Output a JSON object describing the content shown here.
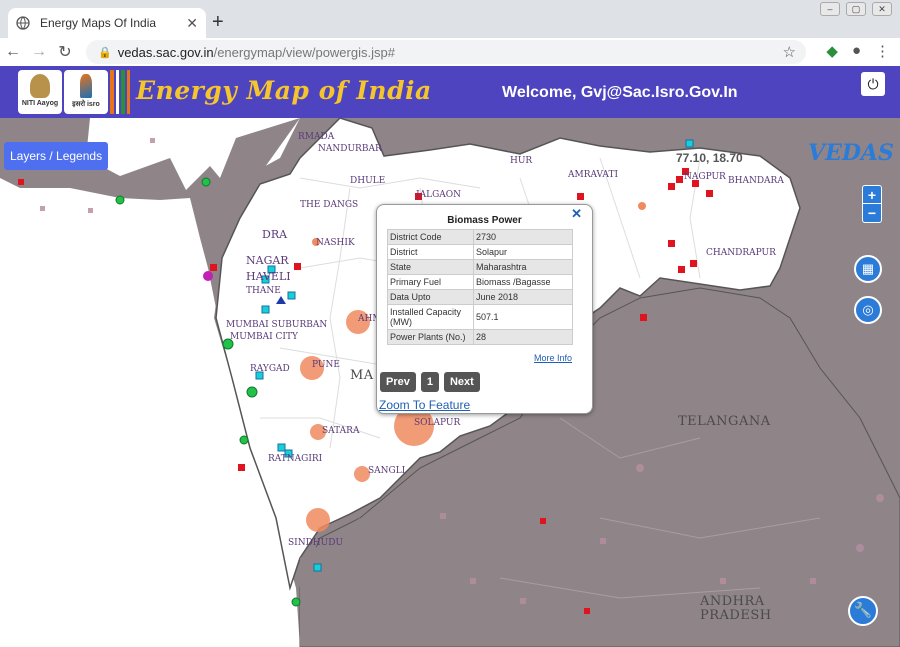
{
  "browser": {
    "tab_title": "Energy Maps Of India",
    "new_tab": "+",
    "url_host": "vedas.sac.gov.in",
    "url_path": "/energymap/view/powergis.jsp#"
  },
  "header": {
    "logo_niti": "NITI Aayog",
    "logo_isro": "इसरो isro",
    "title": "Energy Map of India",
    "welcome": "Welcome, Gvj@Sac.Isro.Gov.In",
    "brand_color": "#4e44bf",
    "title_color": "#f5c52d"
  },
  "map": {
    "layers_button": "Layers / Legends",
    "coordinates": "77.10, 18.70",
    "vedas_logo": "VEDAS",
    "zoom_in": "+",
    "zoom_out": "−",
    "labels": {
      "narmada": "RMADA",
      "nandurbar": "NANDURBAR",
      "dhule": "DHULE",
      "jalgaon": "JALGAON",
      "dangs": "THE DANGS",
      "nashik": "NASHIK",
      "dra": "DRA",
      "nagar": "NAGAR",
      "haveli": "HAVELI",
      "thane": "THANE",
      "mumbai_sub": "MUMBAI SUBURBAN",
      "mumbai_city": "MUMBAI CITY",
      "raygad": "RAYGAD",
      "pune": "PUNE",
      "ma": "MA",
      "ahm": "AHM",
      "satara": "SATARA",
      "ratnagiri": "RATNAGIRI",
      "sangli": "SANGLI",
      "solapur": "SOLAPUR",
      "sindhudurg": "SINDHUDU",
      "hur": "HUR",
      "amravati": "AMRAVATI",
      "nagpur": "NAGPUR",
      "bhandara": "BHANDARA",
      "chandrapur": "CHANDRAPUR",
      "telangana": "TELANGANA",
      "andhra": "ANDHRA",
      "pradesh": "PRADESH"
    }
  },
  "popup": {
    "title": "Biomass Power",
    "close": "✕",
    "rows": [
      {
        "key": "District Code",
        "value": "2730"
      },
      {
        "key": "District",
        "value": "Solapur"
      },
      {
        "key": "State",
        "value": "Maharashtra"
      },
      {
        "key": "Primary Fuel",
        "value": "Biomass /Bagasse"
      },
      {
        "key": "Data Upto",
        "value": "June 2018"
      },
      {
        "key": "Installed Capacity (MW)",
        "value": "507.1"
      },
      {
        "key": "Power Plants (No.)",
        "value": "28"
      }
    ],
    "more_info": "More Info",
    "prev": "Prev",
    "page": "1",
    "next": "Next",
    "zoom_to_feature": "Zoom To Feature"
  }
}
